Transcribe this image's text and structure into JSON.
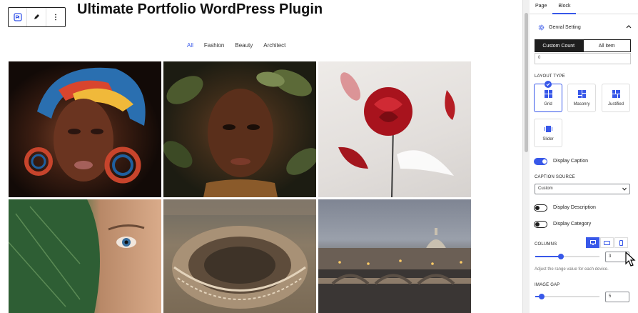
{
  "editor": {
    "page_title": "Ultimate Portfolio WordPress Plugin",
    "filters": [
      {
        "label": "All",
        "active": true
      },
      {
        "label": "Fashion",
        "active": false
      },
      {
        "label": "Beauty",
        "active": false
      },
      {
        "label": "Architect",
        "active": false
      }
    ],
    "gallery": [
      {
        "subject": "portrait-woman-headwrap-earrings"
      },
      {
        "subject": "portrait-woman-leaves"
      },
      {
        "subject": "red-rose-feather"
      },
      {
        "subject": "face-behind-leaf"
      },
      {
        "subject": "colosseum-aerial"
      },
      {
        "subject": "rome-bridge-dusk"
      }
    ]
  },
  "sidebar": {
    "tabs": [
      {
        "label": "Page",
        "active": false
      },
      {
        "label": "Block",
        "active": true
      }
    ],
    "panel_title": "Genral Setting",
    "count_mode": {
      "options": [
        "Custom Count",
        "All item"
      ],
      "selected": "Custom Count"
    },
    "custom_count_value": "0",
    "layout_type_label": "LAYOUT TYPE",
    "layouts": [
      {
        "label": "Grid",
        "selected": true
      },
      {
        "label": "Masonry",
        "selected": false
      },
      {
        "label": "Justified",
        "selected": false
      },
      {
        "label": "Slider",
        "selected": false
      }
    ],
    "display_caption": {
      "label": "Display Caption",
      "on": true
    },
    "caption_source_label": "CAPTION SOURCE",
    "caption_source_value": "Custom",
    "display_description": {
      "label": "Display Description",
      "on": false
    },
    "display_category": {
      "label": "Display Category",
      "on": false
    },
    "columns": {
      "label": "COLUMNS",
      "value": "3",
      "min": 1,
      "max": 6,
      "active_device": "desktop"
    },
    "help_text": "Adjust the range value for each device.",
    "image_gap": {
      "label": "IMAGE GAP",
      "value": "5",
      "min": 0,
      "max": 50
    }
  },
  "colors": {
    "accent": "#3858e9",
    "dark": "#1e1e1e"
  }
}
